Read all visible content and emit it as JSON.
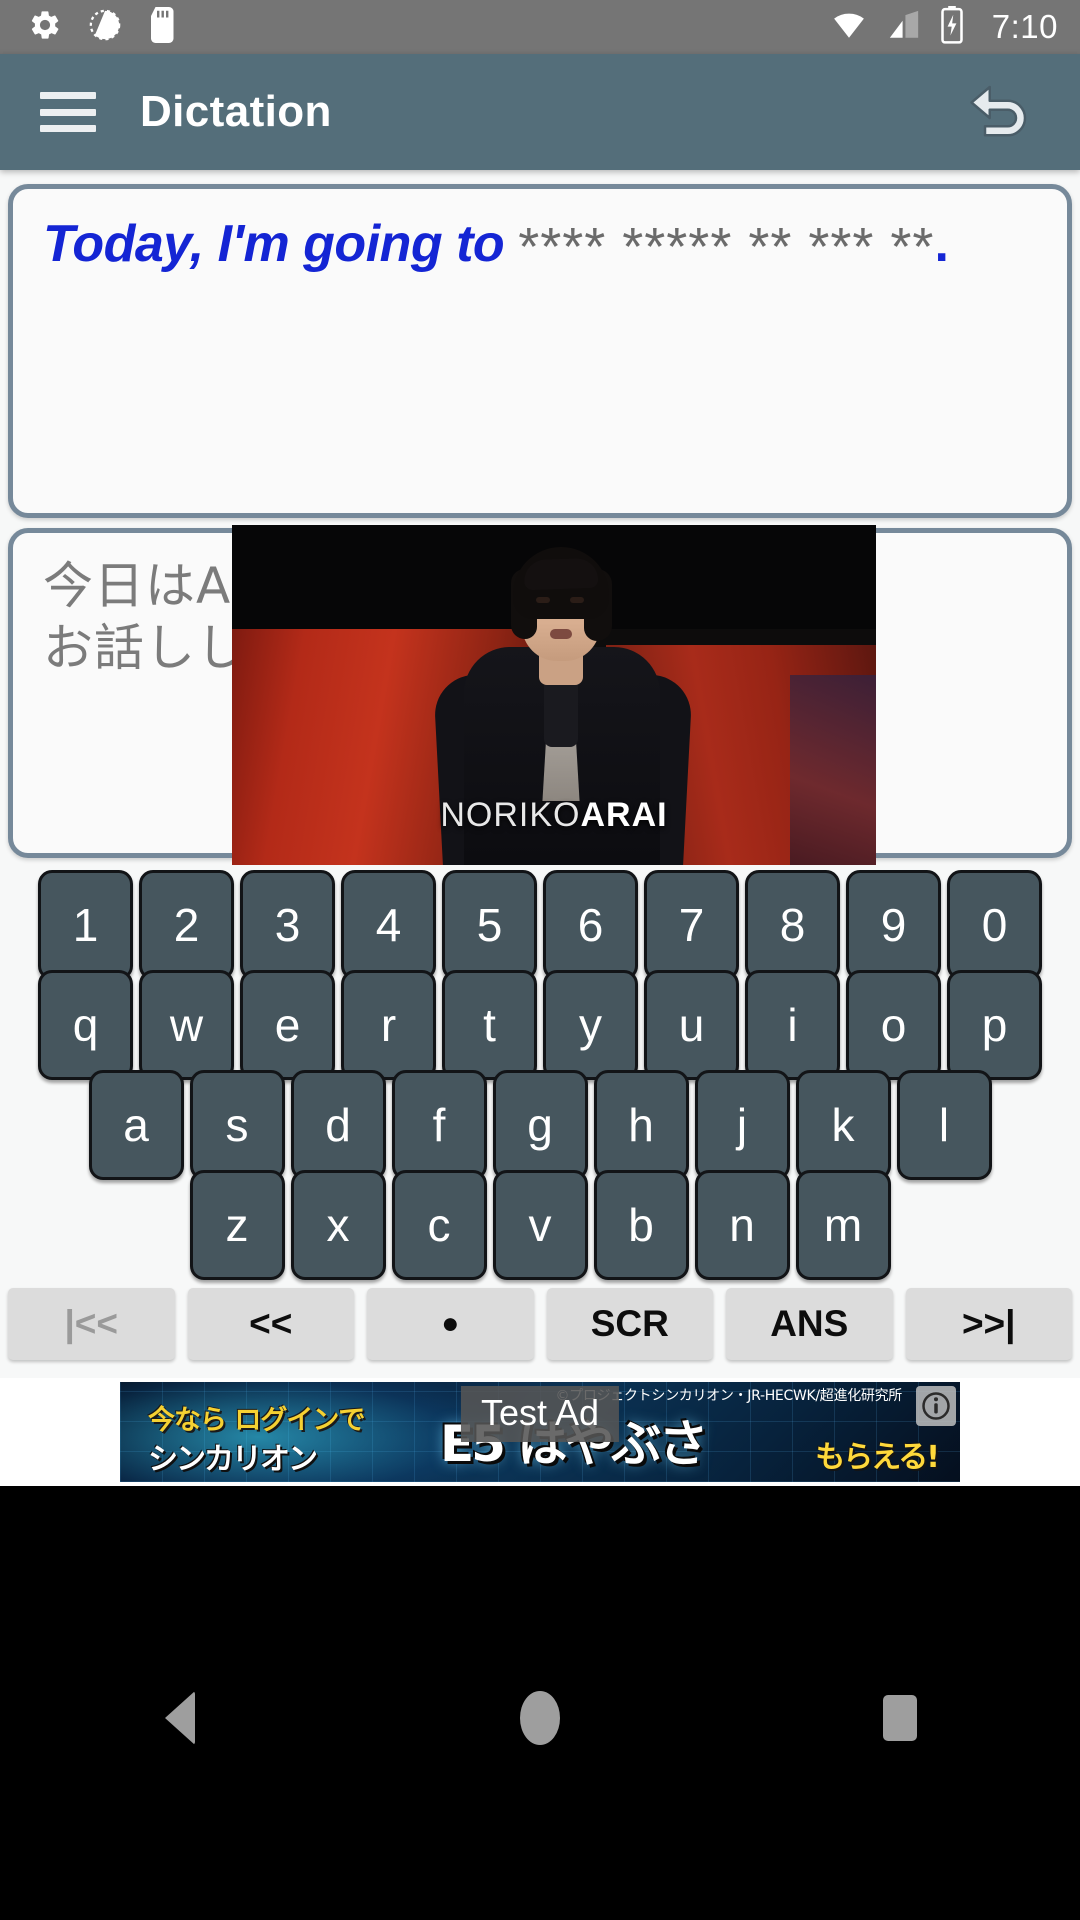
{
  "status_bar": {
    "time": "7:10",
    "left_icons": [
      "gear-icon",
      "sync-progress-icon",
      "sd-card-icon"
    ],
    "right_icons": [
      "wifi-icon",
      "cell-signal-icon",
      "battery-charging-icon"
    ],
    "background_color": "#757575"
  },
  "app_bar": {
    "title": "Dictation",
    "menu_icon": "hamburger-menu-icon",
    "undo_icon": "undo-arrow-icon",
    "background_color": "#546e7a"
  },
  "answer_panel": {
    "revealed_text": "Today, I'm going to",
    "masked_text": "**** ***** ** *** **",
    "trailing_punctuation": ".",
    "revealed_color": "#1425d4",
    "masked_color": "#6b6b6b"
  },
  "source_panel": {
    "line1": "今日はAIと",
    "line2": "お話しし。",
    "text_color": "#7b7b7b"
  },
  "video": {
    "caption_regular": "NORIKO",
    "caption_bold": "ARAI"
  },
  "keyboard": {
    "row_numbers": [
      "1",
      "2",
      "3",
      "4",
      "5",
      "6",
      "7",
      "8",
      "9",
      "0"
    ],
    "row_top": [
      "q",
      "w",
      "e",
      "r",
      "t",
      "y",
      "u",
      "i",
      "o",
      "p"
    ],
    "row_home": [
      "a",
      "s",
      "d",
      "f",
      "g",
      "h",
      "j",
      "k",
      "l"
    ],
    "row_bottom": [
      "z",
      "x",
      "c",
      "v",
      "b",
      "n",
      "m"
    ],
    "key_color": "#46565e",
    "key_text_color": "#ffffff"
  },
  "control_bar": {
    "buttons": [
      {
        "label": "|<<",
        "name": "first-button",
        "disabled": true
      },
      {
        "label": "<<",
        "name": "previous-button",
        "disabled": false
      },
      {
        "label": "●",
        "name": "record-button",
        "disabled": false
      },
      {
        "label": "SCR",
        "name": "script-button",
        "disabled": false
      },
      {
        "label": "ANS",
        "name": "answer-button",
        "disabled": false
      },
      {
        "label": ">>|",
        "name": "next-button",
        "disabled": false
      }
    ]
  },
  "ad": {
    "test_label": "Test Ad",
    "headline_top": "今なら ログインで",
    "headline_big": "E5 はやぶさ",
    "headline_bottom": "シンカリオン",
    "headline_yellow": "もらえる!",
    "copyright": "©プロジェクトシンカリオン・JR-HECWK/超進化研究所",
    "info_icon": "info-icon"
  },
  "nav_bar": {
    "back_label": "back-icon",
    "home_label": "home-icon",
    "recents_label": "recents-icon"
  }
}
